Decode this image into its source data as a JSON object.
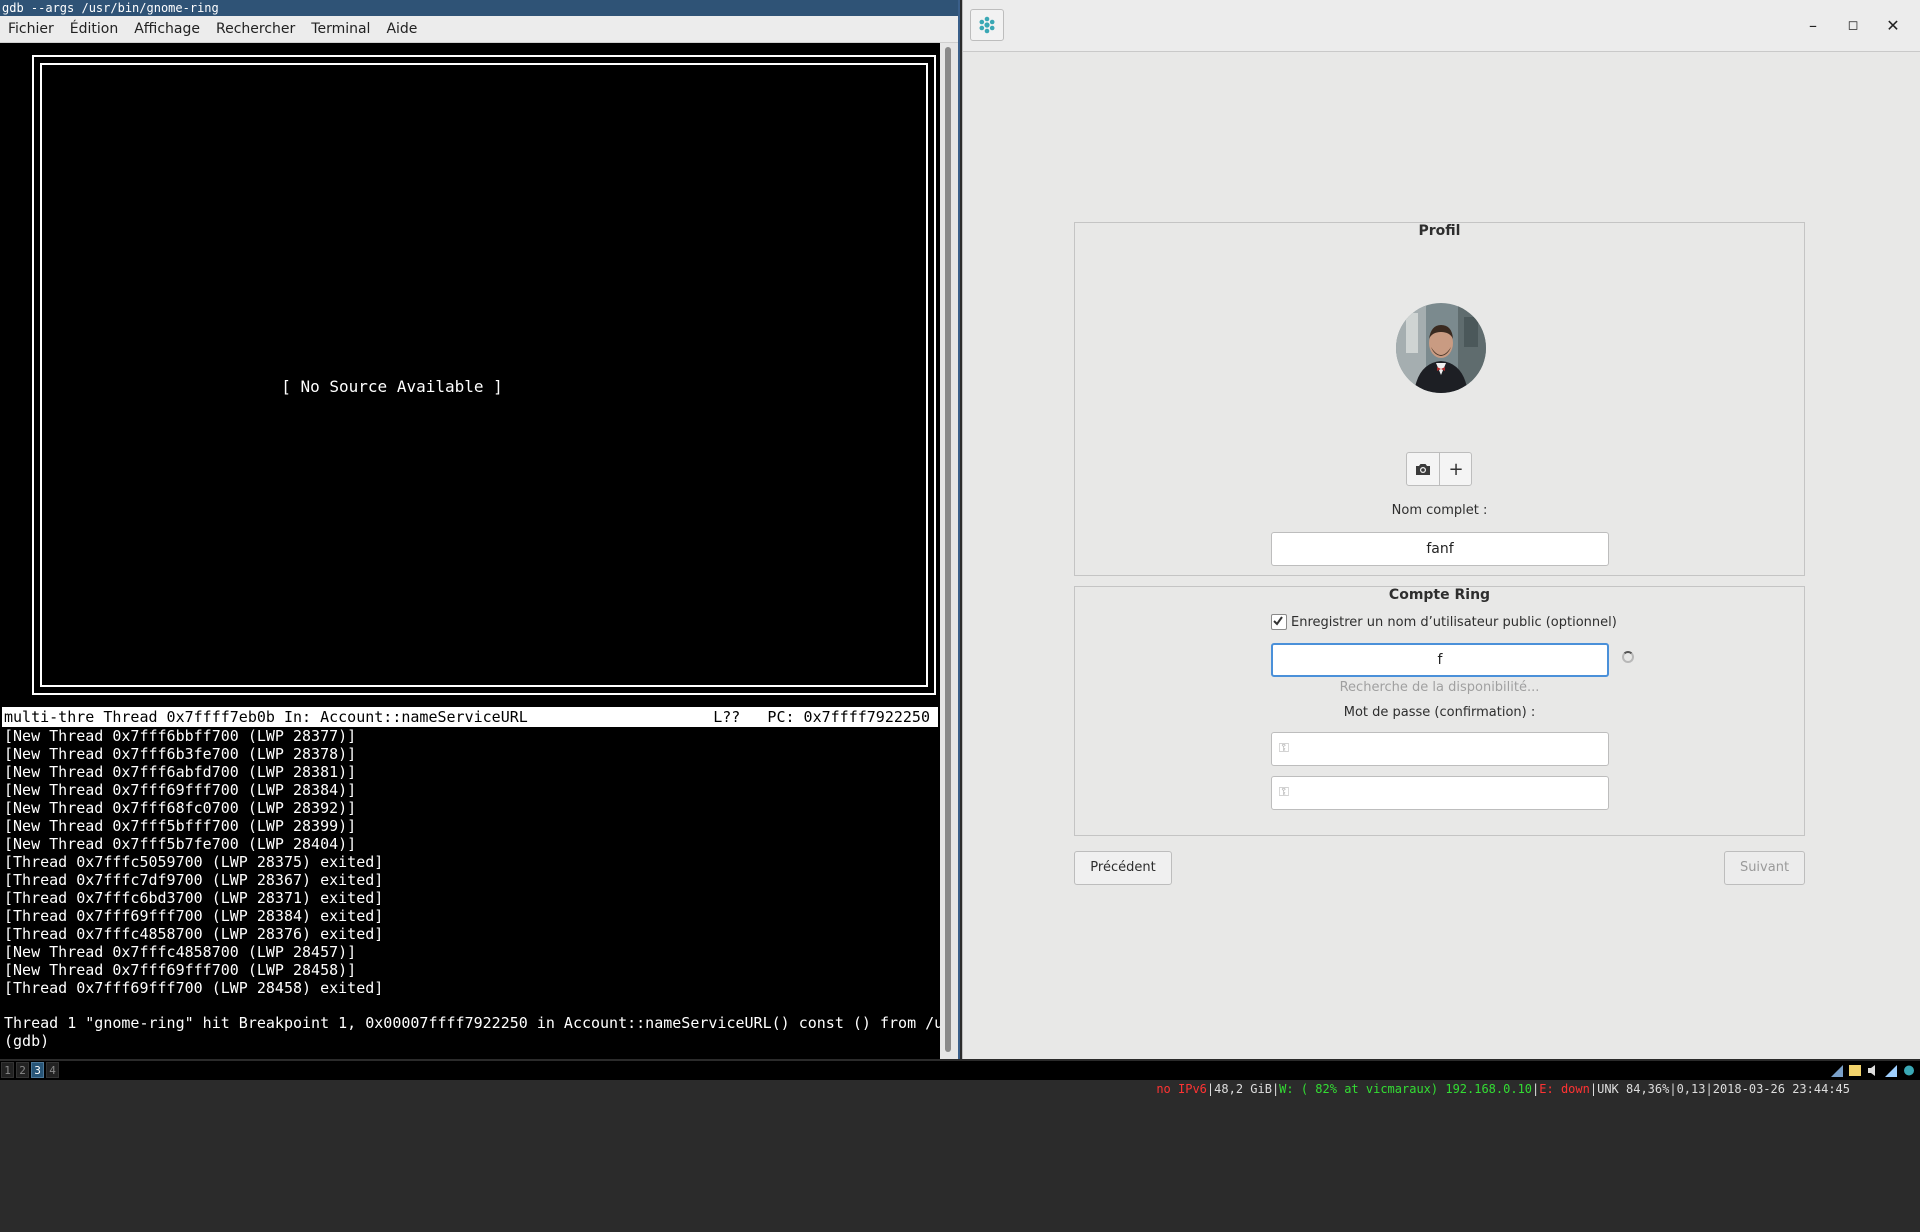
{
  "terminal": {
    "title": "gdb --args /usr/bin/gnome-ring",
    "menu": [
      "Fichier",
      "Édition",
      "Affichage",
      "Rechercher",
      "Terminal",
      "Aide"
    ],
    "no_source": "[ No Source Available ]",
    "status_left": "multi-thre Thread 0x7ffff7eb0b In: Account::nameServiceURL",
    "status_right": "L??   PC: 0x7ffff7922250",
    "log": [
      "[New Thread 0x7fff6bbff700 (LWP 28377)]",
      "[New Thread 0x7fff6b3fe700 (LWP 28378)]",
      "[New Thread 0x7fff6abfd700 (LWP 28381)]",
      "[New Thread 0x7fff69fff700 (LWP 28384)]",
      "[New Thread 0x7fff68fc0700 (LWP 28392)]",
      "[New Thread 0x7fff5bfff700 (LWP 28399)]",
      "[New Thread 0x7fff5b7fe700 (LWP 28404)]",
      "[Thread 0x7fffc5059700 (LWP 28375) exited]",
      "[Thread 0x7fffc7df9700 (LWP 28367) exited]",
      "[Thread 0x7fffc6bd3700 (LWP 28371) exited]",
      "[Thread 0x7fff69fff700 (LWP 28384) exited]",
      "[Thread 0x7fffc4858700 (LWP 28376) exited]",
      "[New Thread 0x7fffc4858700 (LWP 28457)]",
      "[New Thread 0x7fff69fff700 (LWP 28458)]",
      "[Thread 0x7fff69fff700 (LWP 28458) exited]"
    ],
    "hit": "Thread 1 \"gnome-ring\" hit Breakpoint 1, 0x00007ffff7922250 in Account::nameServiceURL() const () from /u",
    "prompt": "(gdb)"
  },
  "ring": {
    "app_icon": "ring-logo-icon",
    "controls": {
      "minimize": "–",
      "maximize": "◻",
      "close": "✕"
    },
    "profile": {
      "title": "Profil",
      "camera_icon": "camera-icon",
      "add_label": "+",
      "fullname_label": "Nom complet :",
      "fullname_value": "fanf"
    },
    "account": {
      "title": "Compte Ring",
      "register_label": "Enregistrer un nom d’utilisateur public (optionnel)",
      "register_checked": true,
      "username_value": "f",
      "lookup_status": "Recherche de la disponibilité...",
      "password_confirm_label": "Mot de passe (confirmation) :",
      "password_value": "",
      "password_confirm_value": ""
    },
    "nav": {
      "previous": "Précédent",
      "next": "Suivant"
    }
  },
  "bar": {
    "workspaces": [
      "1",
      "2",
      "3",
      "4"
    ],
    "active_workspace": "3",
    "status": [
      {
        "text": "no IPv6",
        "color": "#ff3333"
      },
      {
        "text": "48,2 GiB",
        "color": "#dddddd"
      },
      {
        "text": "W: ( 82% at vicmaraux) 192.168.0.10",
        "color": "#33dd33"
      },
      {
        "text": "E: down",
        "color": "#ff3333"
      },
      {
        "text": "UNK 84,36%",
        "color": "#dddddd"
      },
      {
        "text": "0,13",
        "color": "#dddddd"
      },
      {
        "text": "2018-03-26 23:44:45",
        "color": "#dddddd"
      }
    ]
  }
}
